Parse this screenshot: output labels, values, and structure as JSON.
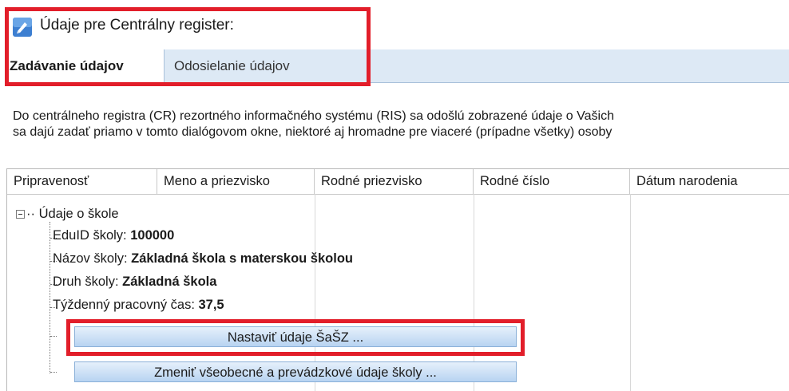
{
  "window": {
    "title": "Údaje pre Centrálny register:",
    "icon": "app-icon",
    "accent_color": "#3d7fd1"
  },
  "tabs": [
    {
      "label": "Zadávanie údajov",
      "active": true
    },
    {
      "label": "Odosielanie údajov",
      "active": false
    }
  ],
  "description": {
    "line1": "Do centrálneho registra (CR) rezortného informačného systému (RIS) sa odošlú zobrazené údaje o Vašich",
    "line2": "sa dajú zadať priamo v tomto dialógovom okne, niektoré aj hromadne pre viaceré (prípadne všetky) osoby"
  },
  "grid": {
    "columns": [
      "Pripravenosť",
      "Meno a priezvisko",
      "Rodné priezvisko",
      "Rodné číslo",
      "Dátum narodenia"
    ],
    "tree": {
      "root_label": "Údaje o škole",
      "rows": [
        {
          "label": "EduID školy: ",
          "value": "100000"
        },
        {
          "label": "Názov školy: ",
          "value": "Základná škola s materskou školou"
        },
        {
          "label": "Druh školy: ",
          "value": "Základná škola"
        },
        {
          "label": "Týždenný pracovný čas: ",
          "value": "37,5"
        }
      ],
      "button1": "Nastaviť údaje ŠaŠZ ...",
      "button2": "Zmeniť všeobecné a prevádzkové údaje školy ..."
    }
  },
  "highlight_color": "#e21e2a"
}
